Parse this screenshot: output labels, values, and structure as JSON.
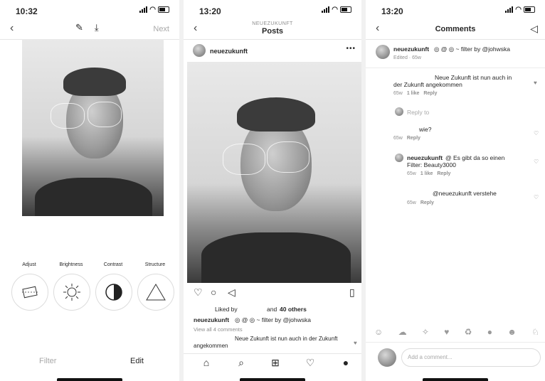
{
  "panel1": {
    "time": "10:32",
    "next_label": "Next",
    "tools": [
      "Adjust",
      "Brightness",
      "Contrast",
      "Structure"
    ],
    "tabs": [
      "Filter",
      "Edit"
    ]
  },
  "panel2": {
    "time": "13:20",
    "header_sub": "NEUEZUKUNFT",
    "header_title": "Posts",
    "username": "neuezukunft",
    "liked_by": "Liked by",
    "likes_and": "and",
    "likes_others": "40 others",
    "caption_user": "neuezukunft",
    "caption_text": "◎ @ ◎ ~ filter by @johwska",
    "view_all": "View all 4 comments",
    "comment_text": "Neue Zukunft ist nun auch in der Zukunft angekommen"
  },
  "panel3": {
    "time": "13:20",
    "header_title": "Comments",
    "caption_user": "neuezukunft",
    "caption_text": "◎ @ ◎ ~ filter by @johwska",
    "caption_meta": "Edited · 65w",
    "comments": [
      {
        "text": "Neue Zukunft ist nun auch in der Zukunft angekommen",
        "time": "65w",
        "likes": "1 like",
        "reply": "Reply"
      },
      {
        "text": "wie?",
        "time": "65w",
        "reply": "Reply"
      },
      {
        "user": "neuezukunft",
        "text": "@                Es gibt da so einen Filter: Beauty3000",
        "time": "65w",
        "likes": "1 like",
        "reply": "Reply"
      },
      {
        "text": "@neuezukunft verstehe",
        "time": "65w",
        "reply": "Reply"
      }
    ],
    "reply_to": "Reply to",
    "input_placeholder": "Add a comment...",
    "emojis": [
      "☺",
      "☁",
      "✧",
      "♥",
      "♻",
      "●",
      "☻",
      "♘"
    ]
  }
}
